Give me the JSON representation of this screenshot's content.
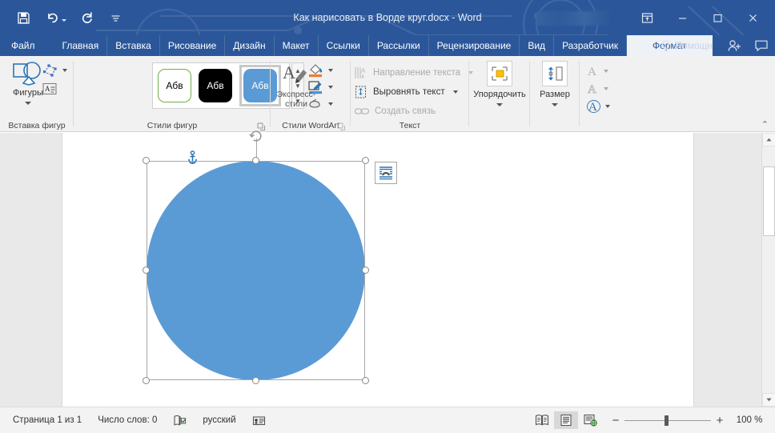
{
  "titlebar": {
    "document_title": "Как нарисовать в Ворде круг.docx  -  Word",
    "quick_access": [
      {
        "name": "save",
        "label": "Сохранить"
      },
      {
        "name": "undo",
        "label": "Отменить"
      },
      {
        "name": "redo",
        "label": "Вернуть"
      },
      {
        "name": "customize-qat",
        "label": "Настройка панели быстрого доступа"
      }
    ],
    "user_name_redacted": "",
    "ribbon_display_options_label": "Параметры отображения ленты",
    "minimize_label": "Свернуть",
    "restore_label": "Развернуть",
    "close_label": "Закрыть",
    "bar_color": "#2b579a"
  },
  "tabs": {
    "items": [
      {
        "label": "Файл",
        "active": false
      },
      {
        "label": "Главная",
        "active": false
      },
      {
        "label": "Вставка",
        "active": false
      },
      {
        "label": "Рисование",
        "active": false
      },
      {
        "label": "Дизайн",
        "active": false
      },
      {
        "label": "Макет",
        "active": false
      },
      {
        "label": "Ссылки",
        "active": false
      },
      {
        "label": "Рассылки",
        "active": false
      },
      {
        "label": "Рецензирование",
        "active": false
      },
      {
        "label": "Вид",
        "active": false
      },
      {
        "label": "Разработчик",
        "active": false
      },
      {
        "label": "Формат",
        "active": true
      }
    ],
    "tell_me": "Помощн",
    "share_label": "Поделиться",
    "comments_label": "Примечания",
    "active_tab_bg": "#eef1f6",
    "active_tab_fg": "#2b579a"
  },
  "ribbon": {
    "collapse_label": "⌃",
    "groups": [
      {
        "name": "insert-shapes",
        "label": "Вставка фигур",
        "shapes_button": "Фигуры",
        "edit_shape_label": "Изменить фигуру",
        "text_box_label": "Надпись"
      },
      {
        "name": "shape-styles",
        "label": "Стили фигур",
        "gallery": [
          {
            "text": "Абв",
            "fill": "#ffffff",
            "stroke": "#70ad47",
            "color": "#000000",
            "selected": false
          },
          {
            "text": "Абв",
            "fill": "#000000",
            "stroke": "#000000",
            "color": "#ffffff",
            "selected": false
          },
          {
            "text": "Абв",
            "fill": "#5b9bd5",
            "stroke": "#5b9bd5",
            "color": "#ffffff",
            "selected": true
          }
        ],
        "shape_fill_label": "Заливка фигуры",
        "shape_outline_label": "Контур фигуры",
        "shape_effects_label": "Эффекты фигуры"
      },
      {
        "name": "wordart-styles",
        "label": "Стили WordArt",
        "quick_styles_line1": "Экспресс-",
        "quick_styles_line2": "стили",
        "text_fill_label": "Заливка текста",
        "text_outline_label": "Контур текста",
        "text_effects_label": "Текстовые эффекты"
      },
      {
        "name": "text",
        "label": "Текст",
        "items": [
          {
            "label": "Направление текста",
            "dimmed": true,
            "has_caret": true
          },
          {
            "label": "Выровнять текст",
            "dimmed": false,
            "has_caret": true
          },
          {
            "label": "Создать связь",
            "dimmed": true,
            "has_caret": false
          }
        ]
      },
      {
        "name": "arrange",
        "label": "",
        "button": "Упорядочить"
      },
      {
        "name": "size",
        "label": "",
        "button": "Размер"
      }
    ]
  },
  "document": {
    "shape": {
      "name": "circle",
      "fill": "#5b9bd5",
      "selected": true,
      "handle_count": 8
    },
    "anchor_label": "Привязка объекта",
    "layout_options_label": "Параметры разметки",
    "page_background": "#ffffff",
    "canvas_background": "#e9e9e9"
  },
  "statusbar": {
    "page_info": "Страница 1 из 1",
    "word_count": "Число слов: 0",
    "proofing_label": "Проверка правописания",
    "language": "русский",
    "accessibility_label": "Специальные возможности",
    "views": [
      {
        "name": "read-mode",
        "label": "Режим чтения",
        "active": false
      },
      {
        "name": "print-layout",
        "label": "Разметка страницы",
        "active": true
      },
      {
        "name": "web-layout",
        "label": "Веб-документ",
        "active": false
      }
    ],
    "zoom_out_label": "−",
    "zoom_in_label": "+",
    "zoom_value": "100 %",
    "zoom_percent": 100
  }
}
